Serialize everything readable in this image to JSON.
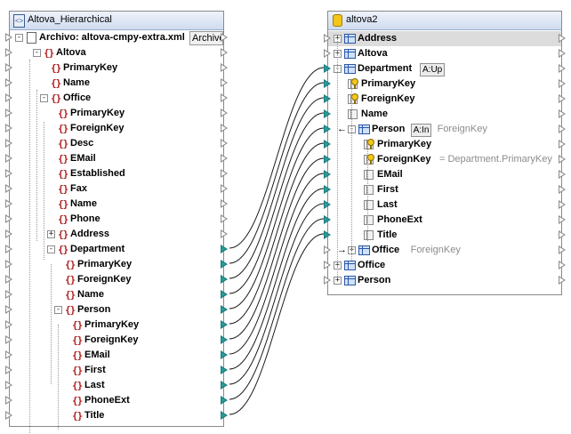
{
  "left_component": {
    "title": "Altova_Hierarchical",
    "file_row": {
      "label": "Archivo: altova-cmpy-extra.xml",
      "button": "Archivo:"
    },
    "tree": [
      {
        "label": "Altova",
        "depth": 0,
        "toggle": "-"
      },
      {
        "label": "PrimaryKey",
        "depth": 1
      },
      {
        "label": "Name",
        "depth": 1
      },
      {
        "label": "Office",
        "depth": 1,
        "toggle": "-"
      },
      {
        "label": "PrimaryKey",
        "depth": 2
      },
      {
        "label": "ForeignKey",
        "depth": 2
      },
      {
        "label": "Desc",
        "depth": 2
      },
      {
        "label": "EMail",
        "depth": 2
      },
      {
        "label": "Established",
        "depth": 2
      },
      {
        "label": "Fax",
        "depth": 2
      },
      {
        "label": "Name",
        "depth": 2
      },
      {
        "label": "Phone",
        "depth": 2
      },
      {
        "label": "Address",
        "depth": 2,
        "toggle": "+"
      },
      {
        "label": "Department",
        "depth": 2,
        "toggle": "-"
      },
      {
        "label": "PrimaryKey",
        "depth": 3
      },
      {
        "label": "ForeignKey",
        "depth": 3
      },
      {
        "label": "Name",
        "depth": 3
      },
      {
        "label": "Person",
        "depth": 3,
        "toggle": "-"
      },
      {
        "label": "PrimaryKey",
        "depth": 4
      },
      {
        "label": "ForeignKey",
        "depth": 4
      },
      {
        "label": "EMail",
        "depth": 4
      },
      {
        "label": "First",
        "depth": 4
      },
      {
        "label": "Last",
        "depth": 4
      },
      {
        "label": "PhoneExt",
        "depth": 4
      },
      {
        "label": "Title",
        "depth": 4
      }
    ]
  },
  "right_component": {
    "title": "altova2",
    "tree": [
      {
        "label": "Address",
        "kind": "table",
        "toggle": "+",
        "selected": true
      },
      {
        "label": "Altova",
        "kind": "table",
        "toggle": "+"
      },
      {
        "label": "Department",
        "kind": "table",
        "toggle": "-",
        "tag": "A:Up"
      },
      {
        "label": "PrimaryKey",
        "kind": "key"
      },
      {
        "label": "ForeignKey",
        "kind": "key"
      },
      {
        "label": "Name",
        "kind": "col"
      },
      {
        "label": "Person",
        "kind": "table",
        "toggle": "-",
        "tag": "A:In",
        "note": "ForeignKey",
        "arrow": "←"
      },
      {
        "label": "PrimaryKey",
        "kind": "key"
      },
      {
        "label": "ForeignKey",
        "kind": "key",
        "note": "= Department.PrimaryKey"
      },
      {
        "label": "EMail",
        "kind": "col"
      },
      {
        "label": "First",
        "kind": "col"
      },
      {
        "label": "Last",
        "kind": "col"
      },
      {
        "label": "PhoneExt",
        "kind": "col"
      },
      {
        "label": "Title",
        "kind": "col"
      },
      {
        "label": "Office",
        "kind": "table",
        "toggle": "+",
        "note": "ForeignKey",
        "arrow": "→"
      },
      {
        "label": "Office",
        "kind": "table",
        "toggle": "+"
      },
      {
        "label": "Person",
        "kind": "table",
        "toggle": "+"
      }
    ]
  },
  "mappings": [
    {
      "from": "Department",
      "to": "Department"
    },
    {
      "from": "PrimaryKey",
      "to": "PrimaryKey"
    },
    {
      "from": "ForeignKey",
      "to": "ForeignKey"
    },
    {
      "from": "Name",
      "to": "Name"
    },
    {
      "from": "Person",
      "to": "Person"
    },
    {
      "from": "PrimaryKey",
      "to": "PrimaryKey"
    },
    {
      "from": "ForeignKey",
      "to": "ForeignKey"
    },
    {
      "from": "EMail",
      "to": "EMail"
    },
    {
      "from": "First",
      "to": "First"
    },
    {
      "from": "Last",
      "to": "Last"
    },
    {
      "from": "PhoneExt",
      "to": "PhoneExt"
    },
    {
      "from": "Title",
      "to": "Title"
    }
  ],
  "colors": {
    "connector": "#1a1a1a",
    "filled_port": "#2a9a9a",
    "selected_row": "#dcdcdc"
  }
}
